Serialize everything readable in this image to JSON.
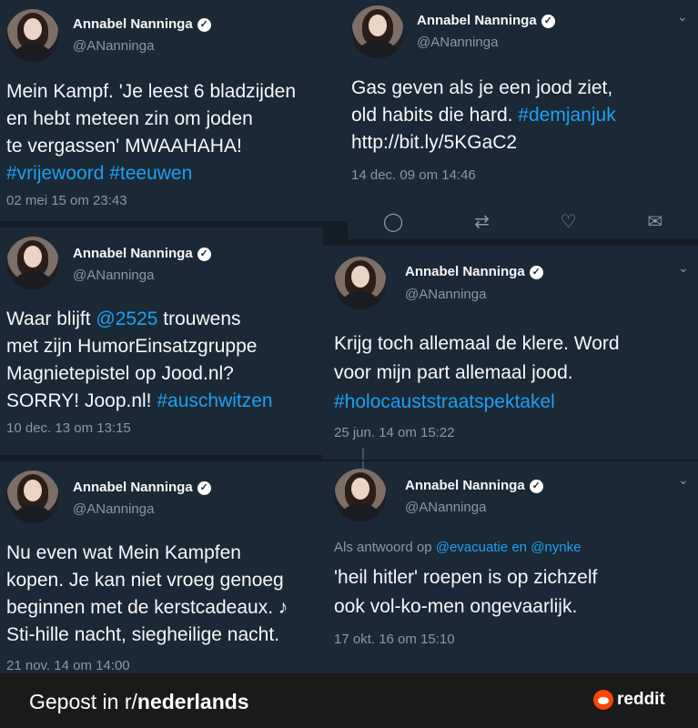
{
  "tweets": [
    {
      "name": "Annabel Nanninga",
      "handle": "@ANanninga",
      "lines": [
        "Mein Kampf. 'Je leest 6 bladzijden",
        "en hebt meteen zin om joden",
        "te vergassen' MWAAHAHA!",
        "#vrijewoord #teeuwen"
      ],
      "date": "02 mei 15 om 23:43"
    },
    {
      "name": "Annabel Nanninga",
      "handle": "@ANanninga",
      "line1": "Gas geven als je een jood ziet,",
      "line2_prefix": "old habits die hard. ",
      "line2_tag": "#demjanjuk",
      "line3": "http://bit.ly/5KGaC2",
      "date": "14 dec. 09 om 14:46"
    },
    {
      "name": "Annabel Nanninga",
      "handle": "@ANanninga",
      "line1_prefix": "Waar blijft ",
      "line1_mention": "@2525",
      "line1_suffix": " trouwens",
      "line2": "met zijn HumorEinsatzgruppe",
      "line3": "Magnietepistel op Jood.nl?",
      "line4_prefix": "SORRY! Joop.nl! ",
      "line4_tag": "#auschwitzen",
      "date": "10 dec. 13 om 13:15"
    },
    {
      "name": "Annabel Nanninga",
      "handle": "@ANanninga",
      "line1": "Krijg toch allemaal de klere. Word",
      "line2": "voor mijn part allemaal jood.",
      "line3": "#holocauststraatspektakel",
      "date": "25 jun. 14 om 15:22"
    },
    {
      "name": "Annabel Nanninga",
      "handle": "@ANanninga",
      "line1": "Nu even wat Mein Kampfen",
      "line2": "kopen. Je kan niet vroeg genoeg",
      "line3": "beginnen met de kerstcadeaux. ♪",
      "line4": "Sti-hille nacht, siegheilige nacht.",
      "date": "21 nov. 14 om 14:00"
    },
    {
      "name": "Annabel Nanninga",
      "handle": "@ANanninga",
      "reply_prefix": "Als antwoord op ",
      "reply_users": "@evacuatie en @nynke",
      "line1": "'heil hitler' roepen is op zichzelf",
      "line2": "ook vol-ko-men ongevaarlijk.",
      "date": "17 okt. 16 om 15:10"
    }
  ],
  "icons": {
    "verified": "✓",
    "chevron": "⌄",
    "reply": "◯",
    "retweet": "⇄",
    "like": "♡",
    "message": "✉"
  },
  "footer": {
    "prefix": "Gepost in r/",
    "subreddit": "nederlands",
    "brand": "reddit"
  },
  "colors": {
    "background": "#141d26",
    "card": "#1b2836",
    "link": "#1da1f2",
    "muted": "#8899a6",
    "reddit": "#ff4500"
  }
}
